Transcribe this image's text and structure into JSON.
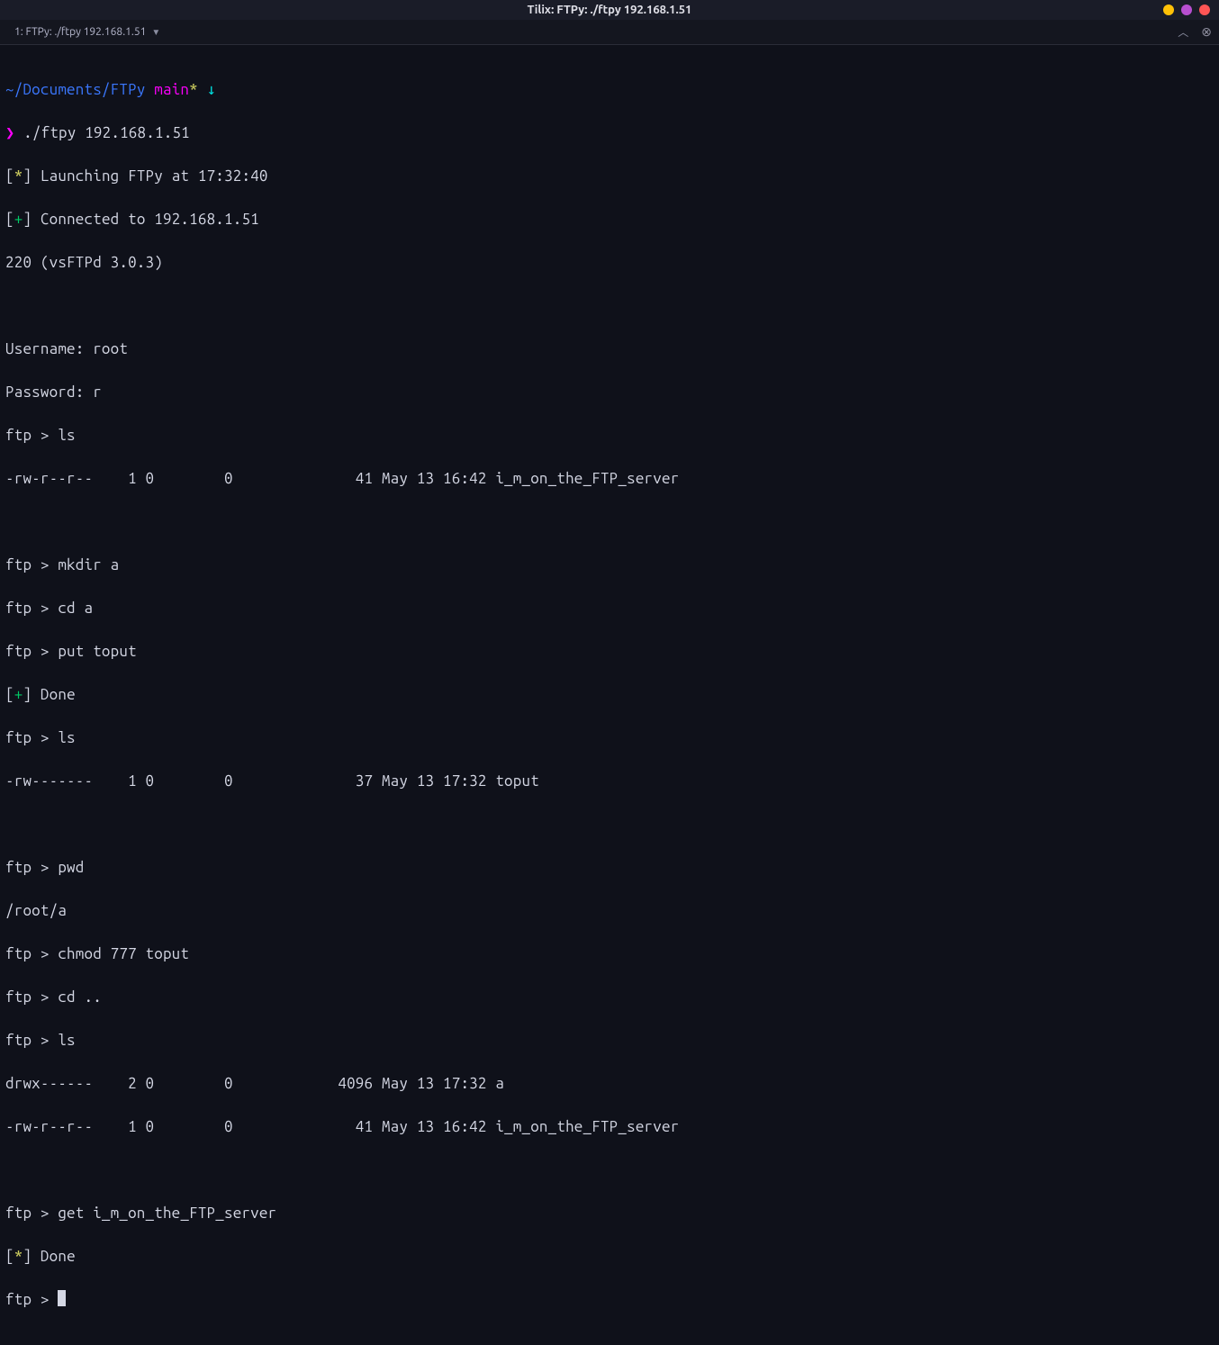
{
  "window": {
    "title": "Tilix: FTPy: ./ftpy 192.168.1.51"
  },
  "tabbar": {
    "tab_label": "1: FTPy: ./ftpy 192.168.1.51"
  },
  "prompt": {
    "path": "~/Documents/FTPy",
    "branch": "main",
    "branch_dirty": "*",
    "arrow_down": "↓",
    "symbol": "❯",
    "command": "./ftpy 192.168.1.51"
  },
  "lines": {
    "l1_b": "[",
    "l1_star": "*",
    "l1_c": "] Launching FTPy at 17:32:40",
    "l2_b": "[",
    "l2_plus": "+",
    "l2_c": "] Connected to 192.168.1.51",
    "l3": "220 (vsFTPd 3.0.3)",
    "l4": "",
    "l5": "Username: root",
    "l6": "Password: r",
    "l7": "ftp > ls",
    "l8": "-rw-r--r--    1 0        0              41 May 13 16:42 i_m_on_the_FTP_server",
    "l9": "",
    "l10": "ftp > mkdir a",
    "l11": "ftp > cd a",
    "l12": "ftp > put toput",
    "l13_b": "[",
    "l13_plus": "+",
    "l13_c": "] Done",
    "l14": "ftp > ls",
    "l15": "-rw-------    1 0        0              37 May 13 17:32 toput",
    "l16": "",
    "l17": "ftp > pwd",
    "l18": "/root/a",
    "l19": "ftp > chmod 777 toput",
    "l20": "ftp > cd ..",
    "l21": "ftp > ls",
    "l22": "drwx------    2 0        0            4096 May 13 17:32 a",
    "l23": "-rw-r--r--    1 0        0              41 May 13 16:42 i_m_on_the_FTP_server",
    "l24": "",
    "l25": "ftp > get i_m_on_the_FTP_server",
    "l26_b": "[",
    "l26_star": "*",
    "l26_c": "] Done",
    "l27": "ftp > "
  }
}
